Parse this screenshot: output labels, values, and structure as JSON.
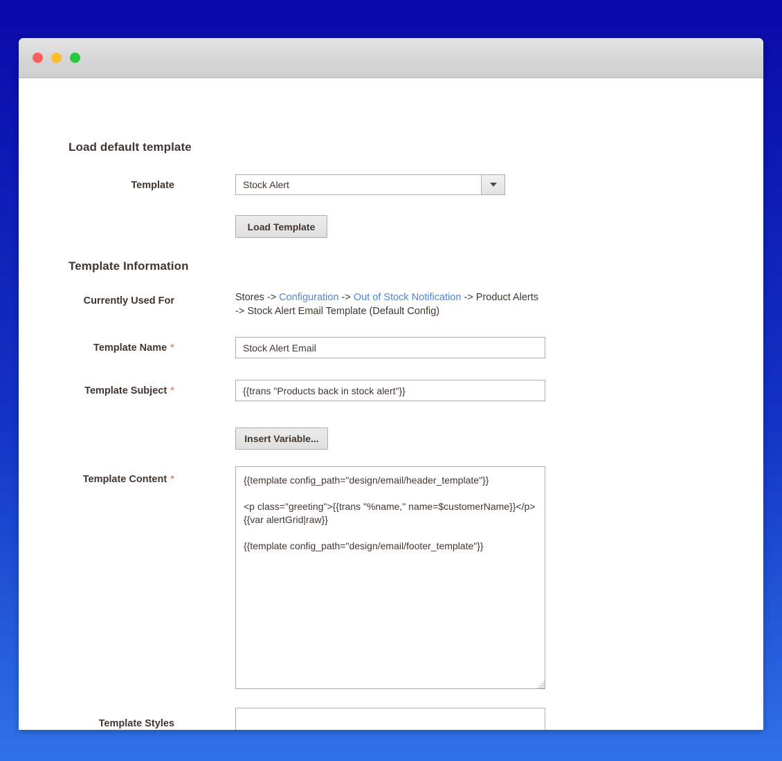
{
  "window": {
    "traffic_lights": [
      "close",
      "minimize",
      "maximize"
    ]
  },
  "load_default_template": {
    "heading": "Load default template",
    "template_label": "Template",
    "template_value": "Stock Alert",
    "load_button": "Load Template"
  },
  "template_information": {
    "heading": "Template Information",
    "currently_used_for": {
      "label": "Currently Used For",
      "part1": "Stores -> ",
      "link1": "Configuration",
      "part2": " -> ",
      "link2": "Out of Stock Notification",
      "part3": " -> Product Alerts -> Stock Alert Email Template  (Default Config)"
    },
    "template_name": {
      "label": "Template Name",
      "required": "*",
      "value": "Stock Alert Email"
    },
    "template_subject": {
      "label": "Template Subject",
      "required": "*",
      "value": "{{trans \"Products back in stock alert\"}}"
    },
    "insert_variable_button": "Insert Variable...",
    "template_content": {
      "label": "Template Content",
      "required": "*",
      "value": "{{template config_path=\"design/email/header_template\"}}\n\n<p class=\"greeting\">{{trans \"%name,\" name=$customerName}}</p>\n{{var alertGrid|raw}}\n\n{{template config_path=\"design/email/footer_template\"}}"
    },
    "template_styles": {
      "label": "Template Styles",
      "value": ""
    }
  },
  "colors": {
    "background_top": "#0a0aa8",
    "background_bottom": "#2f72e8",
    "link": "#5184d6",
    "required_asterisk": "#e8663a",
    "text": "#41362f"
  }
}
